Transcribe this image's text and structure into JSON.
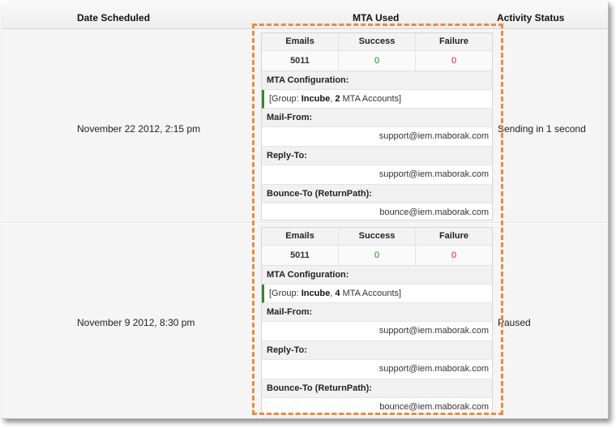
{
  "header": {
    "date_scheduled": "Date Scheduled",
    "mta_used": "MTA Used",
    "activity_status": "Activity Status"
  },
  "rows": [
    {
      "date": "November 22 2012, 2:15 pm",
      "status": "Sending in 1 second",
      "mta": {
        "emails_label": "Emails",
        "success_label": "Success",
        "failure_label": "Failure",
        "emails": "5011",
        "success": "0",
        "failure": "0",
        "config_label": "MTA Configuration:",
        "config_prefix": "[Group: ",
        "config_group": "Incube",
        "config_sep": ", ",
        "config_count": "2",
        "config_suffix": " MTA Accounts]",
        "mail_from_label": "Mail-From:",
        "mail_from": "support@iem.maborak.com",
        "reply_to_label": "Reply-To:",
        "reply_to": "support@iem.maborak.com",
        "bounce_to_label": "Bounce-To (ReturnPath):",
        "bounce_to": "bounce@iem.maborak.com"
      }
    },
    {
      "date": "November 9 2012, 8:30 pm",
      "status": "Paused",
      "mta": {
        "emails_label": "Emails",
        "success_label": "Success",
        "failure_label": "Failure",
        "emails": "5011",
        "success": "0",
        "failure": "0",
        "config_label": "MTA Configuration:",
        "config_prefix": "[Group: ",
        "config_group": "Incube",
        "config_sep": ", ",
        "config_count": "4",
        "config_suffix": " MTA Accounts]",
        "mail_from_label": "Mail-From:",
        "mail_from": "support@iem.maborak.com",
        "reply_to_label": "Reply-To:",
        "reply_to": "support@iem.maborak.com",
        "bounce_to_label": "Bounce-To (ReturnPath):",
        "bounce_to": "bounce@iem.maborak.com"
      }
    }
  ],
  "colors": {
    "highlight": "#ee8a3c",
    "success": "#1a8a1a",
    "failure": "#d42020",
    "config_bar": "#2e8b2e"
  }
}
